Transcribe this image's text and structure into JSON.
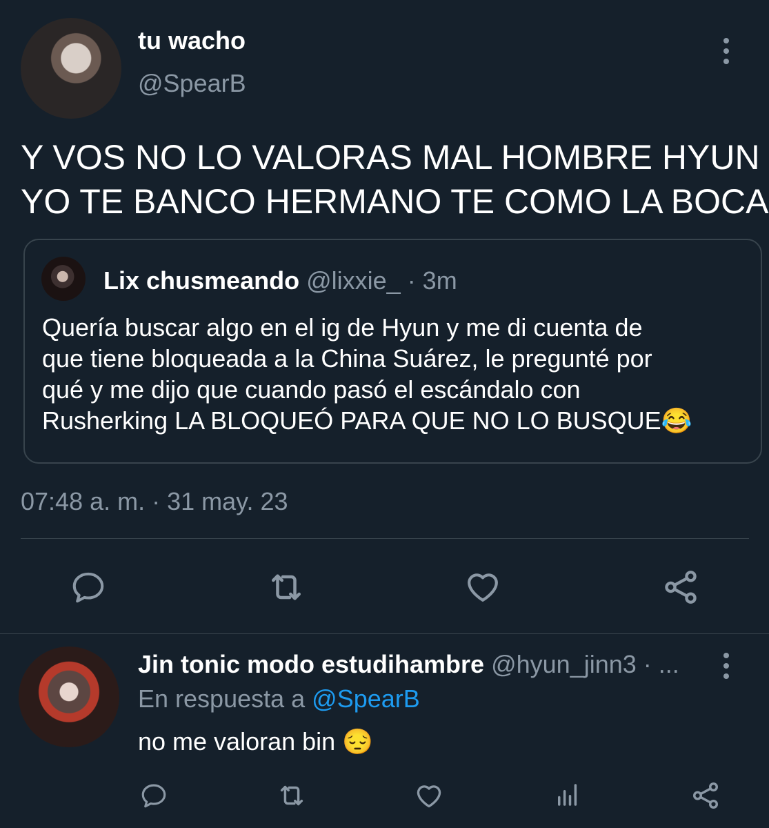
{
  "tweet": {
    "display_name": "tu wacho",
    "handle": "@SpearB",
    "text_line1": "Y VOS NO LO VALORAS MAL HOMBRE HYUN",
    "text_line2": "YO TE BANCO HERMANO TE COMO LA BOCA",
    "timestamp": "07:48 a. m. · 31 may. 23",
    "quoted": {
      "display_name": "Lix chusmeando",
      "handle": "@lixxie_",
      "time": "· 3m",
      "line1": "Quería buscar algo en el ig de Hyun y me di cuenta de",
      "line2": "que tiene bloqueada a la China Suárez, le pregunté por",
      "line3": "qué y me dijo que cuando pasó el escándalo con",
      "line4": "Rusherking LA BLOQUEÓ PARA QUE NO LO BUSQUE",
      "emoji": "😂"
    }
  },
  "reply": {
    "display_name": "Jin tonic modo estudihambre",
    "handle": "@hyun_jinn3 · ...",
    "reply_prefix": "En respuesta a",
    "reply_to": "@SpearB",
    "text": "no me valoran bin",
    "emoji": "😔"
  },
  "colors": {
    "background": "#15202b",
    "text": "#ffffff",
    "muted": "#8b98a5",
    "link": "#1d9bf0",
    "border": "#38444d"
  },
  "icons": [
    "reply-icon",
    "retweet-icon",
    "like-icon",
    "share-icon",
    "stats-icon",
    "more-icon"
  ]
}
